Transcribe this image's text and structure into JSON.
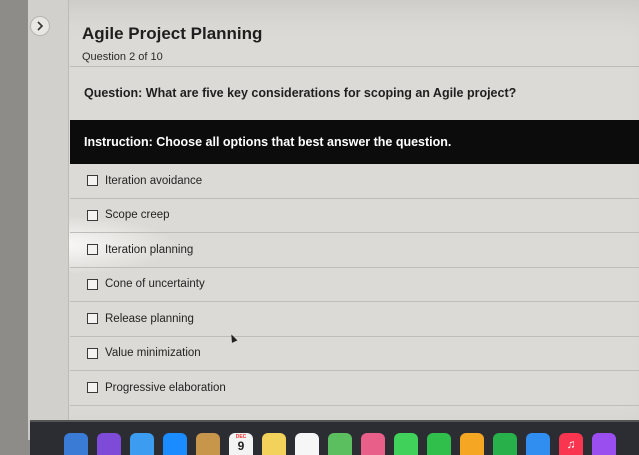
{
  "header": {
    "title": "Agile Project Planning",
    "question_count": "Question 2 of 10",
    "nav_icon": "chevron-right-icon"
  },
  "question": {
    "text": "Question: What are five key considerations for scoping an Agile project?",
    "instruction": "Instruction: Choose all options that best answer the question."
  },
  "options": [
    {
      "label": "Iteration avoidance",
      "checked": false
    },
    {
      "label": "Scope creep",
      "checked": false
    },
    {
      "label": "Iteration planning",
      "checked": false
    },
    {
      "label": "Cone of uncertainty",
      "checked": false
    },
    {
      "label": "Release planning",
      "checked": false
    },
    {
      "label": "Value minimization",
      "checked": false
    },
    {
      "label": "Progressive elaboration",
      "checked": false
    }
  ],
  "dock": {
    "calendar_month": "DEC",
    "calendar_day": "9",
    "icons": [
      {
        "name": "finder-icon",
        "color": "#3a7bd5"
      },
      {
        "name": "launchpad-icon",
        "color": "#7d4bd8"
      },
      {
        "name": "mail-icon",
        "color": "#3b9cf0"
      },
      {
        "name": "safari-icon",
        "color": "#1a8cff"
      },
      {
        "name": "contacts-icon",
        "color": "#c8964a"
      },
      {
        "name": "calendar-icon",
        "color": "#f3f3f3"
      },
      {
        "name": "notes-icon",
        "color": "#f2d25a"
      },
      {
        "name": "reminders-icon",
        "color": "#f6f6f6"
      },
      {
        "name": "maps-icon",
        "color": "#5bbf5f"
      },
      {
        "name": "photos-icon",
        "color": "#e85f8a"
      },
      {
        "name": "messages-icon",
        "color": "#3fd15a"
      },
      {
        "name": "facetime-icon",
        "color": "#2fbf4a"
      },
      {
        "name": "freeform-icon",
        "color": "#f5a623"
      },
      {
        "name": "numbers-icon",
        "color": "#28b04b"
      },
      {
        "name": "keynote-icon",
        "color": "#2f8ef0"
      },
      {
        "name": "music-icon",
        "color": "#fa3550"
      },
      {
        "name": "podcasts-icon",
        "color": "#9b4ef0"
      }
    ]
  }
}
